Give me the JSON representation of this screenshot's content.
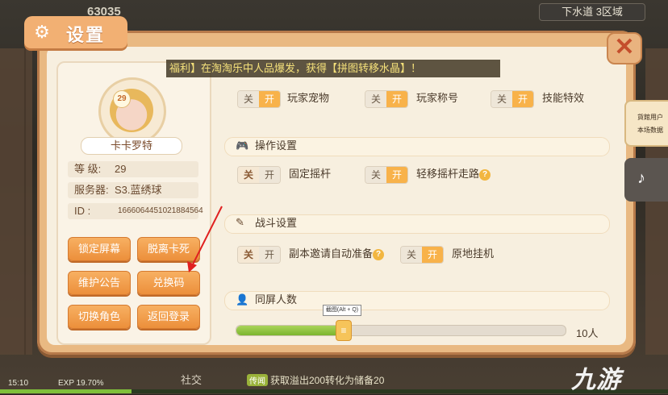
{
  "background": {
    "coins": "63035",
    "region": "下水道 3区域"
  },
  "window": {
    "title": "设置",
    "title_icon": "gear-icon",
    "close_icon": "close-icon"
  },
  "banner": {
    "text": "福利】在淘淘乐中人品爆发，获得【拼图转移水晶】！"
  },
  "profile": {
    "level_badge": "29",
    "name": "卡卡罗特",
    "rows": [
      {
        "label": "等 级:",
        "value": "29"
      },
      {
        "label": "服务器:",
        "value": "S3.蓝绣球"
      },
      {
        "label": "ID  :",
        "value": "1666064451021884564"
      }
    ],
    "buttons": [
      "锁定屏幕",
      "脱离卡死",
      "维护公告",
      "兑换码",
      "切换角色",
      "返回登录"
    ]
  },
  "toggles_top": [
    {
      "off": "关",
      "on": "开",
      "label": "玩家宠物",
      "state": "on"
    },
    {
      "off": "关",
      "on": "开",
      "label": "玩家称号",
      "state": "on"
    },
    {
      "off": "关",
      "on": "开",
      "label": "技能特效",
      "state": "on"
    }
  ],
  "sections": {
    "control": {
      "title": "操作设置",
      "icon": "gamepad-icon"
    },
    "battle": {
      "title": "战斗设置",
      "icon": "sword-icon"
    },
    "screen": {
      "title": "同屏人数",
      "icon": "people-icon"
    }
  },
  "toggles_control": [
    {
      "off": "关",
      "on": "开",
      "label": "固定摇杆",
      "state": "off"
    },
    {
      "off": "关",
      "on": "开",
      "label": "轻移摇杆走路",
      "state": "on"
    }
  ],
  "toggles_battle": [
    {
      "off": "关",
      "on": "开",
      "label": "副本邀请自动准备",
      "state": "off"
    },
    {
      "off": "关",
      "on": "开",
      "label": "原地挂机",
      "state": "on"
    }
  ],
  "slider": {
    "value_label": "10人",
    "fill_fraction": 0.32,
    "tooltip": "截图(Alt + Q)"
  },
  "right_tabs": {
    "tab1_text": "貨館用户",
    "tab1_sub": "本场数据"
  },
  "hud": {
    "time": "15:10",
    "exp": "EXP 19.70%",
    "exp_fraction": 0.197,
    "social": "社交",
    "news_badge": "传闻",
    "news": "获取溢出200转化为储备20"
  },
  "watermark": "九游",
  "colors": {
    "window_frame": "#e9b982",
    "panel_bg": "#f7efdf",
    "button_orange": "#ec8f3b",
    "toggle_on": "#f8b24a",
    "slider_green": "#7cb52e",
    "arrow_red": "#e02020"
  }
}
